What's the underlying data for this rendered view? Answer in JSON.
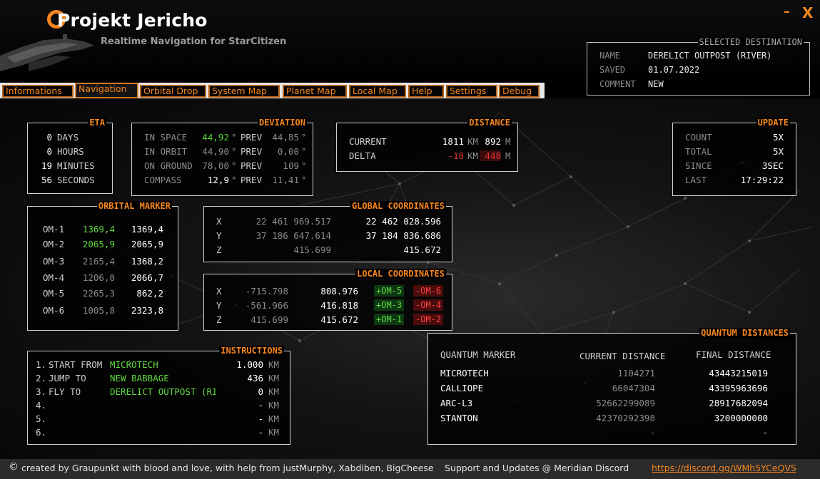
{
  "window": {
    "title": "Projekt Jericho",
    "subtitle": "Realtime Navigation for StarCitizen",
    "minimize_label": "–",
    "close_label": "X"
  },
  "destination": {
    "legend": "SELECTED DESTINATION",
    "name_label": "NAME",
    "name_value": "DERELICT OUTPOST (RIVER)",
    "saved_label": "SAVED",
    "saved_value": "01.07.2022",
    "comment_label": "COMMENT",
    "comment_value": "NEW"
  },
  "tabs": [
    {
      "label": "Informations",
      "active": false
    },
    {
      "label": "Navigation",
      "active": true
    },
    {
      "label": "Orbital Drop",
      "active": false
    },
    {
      "label": "System Map",
      "active": false
    },
    {
      "label": "Planet Map",
      "active": false
    },
    {
      "label": "Local Map",
      "active": false
    },
    {
      "label": "Help",
      "active": false
    },
    {
      "label": "Settings",
      "active": false
    },
    {
      "label": "Debug",
      "active": false
    }
  ],
  "eta": {
    "legend": "ETA",
    "rows": [
      {
        "value": "0",
        "unit": "DAYS"
      },
      {
        "value": "0",
        "unit": "HOURS"
      },
      {
        "value": "19",
        "unit": "MINUTES"
      },
      {
        "value": "56",
        "unit": "SECONDS"
      }
    ]
  },
  "deviation": {
    "legend": "DEVIATION",
    "prev_label": "PREV",
    "deg": "°",
    "rows": [
      {
        "label": "IN SPACE",
        "value": "44,92",
        "prev": "44,85"
      },
      {
        "label": "IN ORBIT",
        "value": "44,90",
        "prev": "0,00"
      },
      {
        "label": "ON GROUND",
        "value": "78,00",
        "prev": "109"
      },
      {
        "label": "COMPASS",
        "value": "12,9",
        "prev": "11,41"
      }
    ]
  },
  "distance": {
    "legend": "DISTANCE",
    "current_label": "CURRENT",
    "current_km": "1811",
    "current_m": "892",
    "delta_label": "DELTA",
    "delta_km": "-10",
    "delta_m": "448",
    "km_unit": "KM",
    "m_unit": "M"
  },
  "update": {
    "legend": "UPDATE",
    "rows": [
      {
        "label": "COUNT",
        "value": "5X"
      },
      {
        "label": "TOTAL",
        "value": "5X"
      },
      {
        "label": "SINCE",
        "value": "3SEC"
      },
      {
        "label": "LAST",
        "value": "17:29:22"
      }
    ]
  },
  "orbital_marker": {
    "legend": "ORBITAL MARKER",
    "rows": [
      {
        "label": "OM-1",
        "current": "1369,4",
        "final": "1369,4"
      },
      {
        "label": "OM-2",
        "current": "2065,9",
        "final": "2065,9"
      },
      {
        "label": "OM-3",
        "current": "2165,4",
        "final": "1368,2"
      },
      {
        "label": "OM-4",
        "current": "1206,0",
        "final": "2066,7"
      },
      {
        "label": "OM-5",
        "current": "2265,3",
        "final": "862,2"
      },
      {
        "label": "OM-6",
        "current": "1005,8",
        "final": "2323,8"
      }
    ]
  },
  "global_coordinates": {
    "legend": "GLOBAL COORDINATES",
    "rows": [
      {
        "axis": "X",
        "current": "22 461 969.517",
        "target": "22 462 028.596"
      },
      {
        "axis": "Y",
        "current": "37 186 647.614",
        "target": "37 184 836.686"
      },
      {
        "axis": "Z",
        "current": "415.699",
        "target": "415.672"
      }
    ]
  },
  "local_coordinates": {
    "legend": "LOCAL COORDINATES",
    "rows": [
      {
        "axis": "X",
        "current": "-715.798",
        "target": "808.976",
        "plus": "+OM-5",
        "minus": "-OM-6"
      },
      {
        "axis": "Y",
        "current": "-561.966",
        "target": "416.818",
        "plus": "+OM-3",
        "minus": "-OM-4"
      },
      {
        "axis": "Z",
        "current": "415.699",
        "target": "415.672",
        "plus": "+OM-1",
        "minus": "-OM-2"
      }
    ]
  },
  "instructions": {
    "legend": "INSTRUCTIONS",
    "unit": "KM",
    "rows": [
      {
        "num": "1.",
        "action": "START FROM",
        "target": "MICROTECH",
        "value": "1.000"
      },
      {
        "num": "2.",
        "action": "JUMP TO",
        "target": "NEW BABBAGE",
        "value": "436"
      },
      {
        "num": "3.",
        "action": "FLY TO",
        "target": "DERELICT OUTPOST (RI",
        "value": "0"
      },
      {
        "num": "4.",
        "action": "",
        "target": "",
        "value": "-"
      },
      {
        "num": "5.",
        "action": "",
        "target": "",
        "value": "-"
      },
      {
        "num": "6.",
        "action": "",
        "target": "",
        "value": "-"
      }
    ]
  },
  "quantum_distances": {
    "legend": "QUANTUM DISTANCES",
    "col_marker": "QUANTUM MARKER",
    "col_current": "CURRENT DISTANCE",
    "col_final": "FINAL DISTANCE",
    "rows": [
      {
        "marker": "MICROTECH",
        "current": "1104271",
        "final": "43443215019"
      },
      {
        "marker": "CALLIOPE",
        "current": "66047304",
        "final": "43395963696"
      },
      {
        "marker": "ARC-L3",
        "current": "52662299089",
        "final": "28917682094"
      },
      {
        "marker": "STANTON",
        "current": "42370292398",
        "final": "3200000000"
      },
      {
        "marker": "",
        "current": "-",
        "final": "-"
      }
    ]
  },
  "footer": {
    "credits": "created by Graupunkt with blood and love, with help from justMurphy, Xabdiben, BigCheese",
    "support": "Support and Updates @ Meridian Discord",
    "link": "https://discord.gg/WMh5YCeQVS"
  },
  "colors": {
    "accent": "#f5861f",
    "positive": "#5fd93f",
    "negative": "#e03030"
  }
}
